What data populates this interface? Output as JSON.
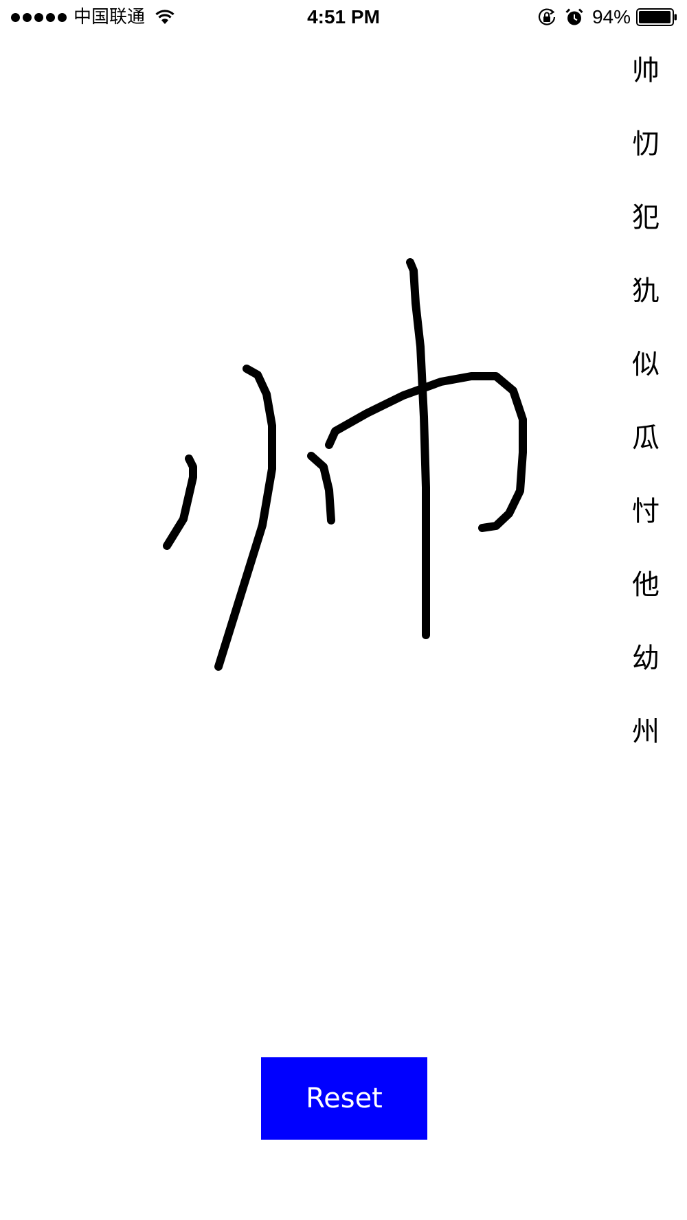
{
  "status_bar": {
    "carrier": "中国联通",
    "time": "4:51 PM",
    "battery_percent": "94%",
    "icons": [
      "signal-dots-icon",
      "wifi-icon",
      "rotation-lock-icon",
      "alarm-icon",
      "battery-icon"
    ]
  },
  "candidates": [
    "帅",
    "忉",
    "犯",
    "犰",
    "似",
    "瓜",
    "忖",
    "他",
    "幼",
    "州"
  ],
  "reset_label": "Reset",
  "colors": {
    "reset_background": "#0000ff",
    "reset_text": "#ffffff",
    "ink": "#000000",
    "background": "#ffffff"
  }
}
